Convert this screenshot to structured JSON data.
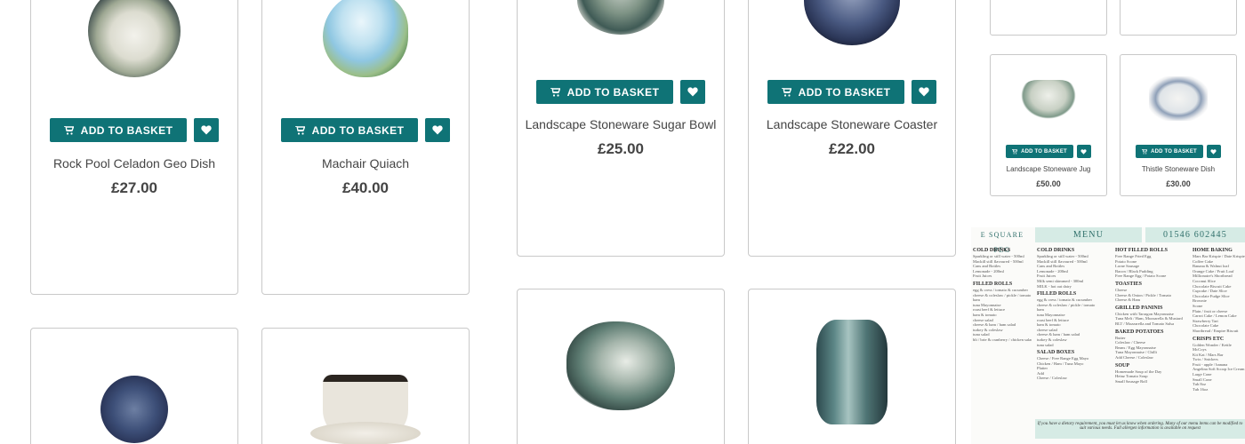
{
  "colors": {
    "accent": "#0f7376",
    "menu_band": "#d6ebe5"
  },
  "icons": {
    "basket": "cart-icon",
    "wishlist": "heart-icon"
  },
  "products": [
    {
      "name": "Rock Pool Celadon Geo Dish",
      "price": "£27.00",
      "button": "ADD TO BASKET"
    },
    {
      "name": "Machair Quiach",
      "price": "£40.00",
      "button": "ADD TO BASKET"
    },
    {
      "name": "Landscape Stoneware Sugar Bowl",
      "price": "£25.00",
      "button": "ADD TO BASKET"
    },
    {
      "name": "Landscape Stoneware Coaster",
      "price": "£22.00",
      "button": "ADD TO BASKET"
    }
  ],
  "mini_products": [
    {
      "name": "Landscape Stoneware Jug",
      "price": "£50.00",
      "button": "ADD TO BASKET"
    },
    {
      "name": "Thistle Stoneware Dish",
      "price": "£30.00",
      "button": "ADD TO BASKET"
    }
  ],
  "menu": {
    "brand": "E SQUARE PEG",
    "title": "MENU",
    "phone": "01546 602445",
    "footer": "If you have a dietary requirement, you must let us know when ordering. Many of our menu items can be modified to suit various needs. Full allergen information is available on request",
    "sections": [
      {
        "title": "COLD DRINKS",
        "items": [
          "Sparkling or still water - 500ml",
          "Mackill still flavoured - 500ml",
          "Cans and Bottles",
          "Lemonade - 200ml",
          "Fruit Juices",
          "Milk semi skimmed - 300ml",
          "MILK - hot oat dairy"
        ]
      },
      {
        "title": "FILLED ROLLS",
        "items": [
          "egg & cress / tomato & cucumber",
          "cheese & coleslaw / pickle / tomato",
          "ham",
          "tuna Mayonnaise",
          "roast beef & lettuce",
          "ham & tomato",
          "cheese salad",
          "cheese & ham / ham salad",
          "turkey & coleslaw",
          "tuna salad",
          "blt / brie & cranberry / chicken salad"
        ]
      },
      {
        "title": "SALAD BOXES",
        "items": [
          "Cheese / Free Range Egg Mayo",
          "Chicken / Ham / Tuna Mayo",
          "Platter",
          "Add",
          "Cheese / Coleslaw"
        ]
      },
      {
        "title": "HOT FILLED ROLLS",
        "items": [
          "Free Range Fried Egg",
          "Potato Scone",
          "Lorne Sausage",
          "Bacon / Black Pudding",
          "Free Range Egg / Potato Scone"
        ]
      },
      {
        "title": "TOASTIES",
        "items": [
          "Cheese",
          "Cheese & Onion / Pickle / Tomato",
          "Cheese & Ham"
        ]
      },
      {
        "title": "GRILLED PANINIS",
        "items": [
          "Chicken with Tarragon Mayonnaise",
          "Tuna Melt / Ham, Mozzarella & Mustard",
          "BLT / Mozzarella and Tomato Salsa"
        ]
      },
      {
        "title": "BAKED POTATOES",
        "items": [
          "Butter",
          "Coleslaw / Cheese",
          "Beans / Egg Mayonnaise",
          "Tuna Mayonnaise / Chilli",
          "Add Cheese / Coleslaw"
        ]
      },
      {
        "title": "SOUP",
        "items": [
          "Homemade Soup of the Day",
          "Heinz Tomato Soup",
          "Small Sausage Roll"
        ]
      },
      {
        "title": "HOME BAKING",
        "items": [
          "Mars Bar Krispie / Date Krispie",
          "Coffee Cake",
          "Banana & Walnut loaf",
          "Orange Cake / Fruit Loaf",
          "Millionaire's Shortbread",
          "Coconut Slice",
          "Chocolate Biscuit Cake",
          "Cupcake / Date Slice",
          "Chocolate Fudge Slice",
          "Brownie",
          "Scone",
          "Plain / fruit or cheese",
          "Carrot Cake / Lemon Cake",
          "Strawberry Tart",
          "Chocolate Cake",
          "Shortbread / Empire Biscuit"
        ]
      },
      {
        "title": "CRISPS ETC",
        "items": [
          "Golden Wonder / Kettle",
          "McCoys",
          "Kit Kat / Mars Bar",
          "Twix / Snickers",
          "Fruit - apple / banana",
          "Angelina Soft Scoop Ice Cream",
          "Large Cone",
          "Small Cone",
          "Tub 8oz",
          "Tub 16oz"
        ]
      }
    ]
  }
}
